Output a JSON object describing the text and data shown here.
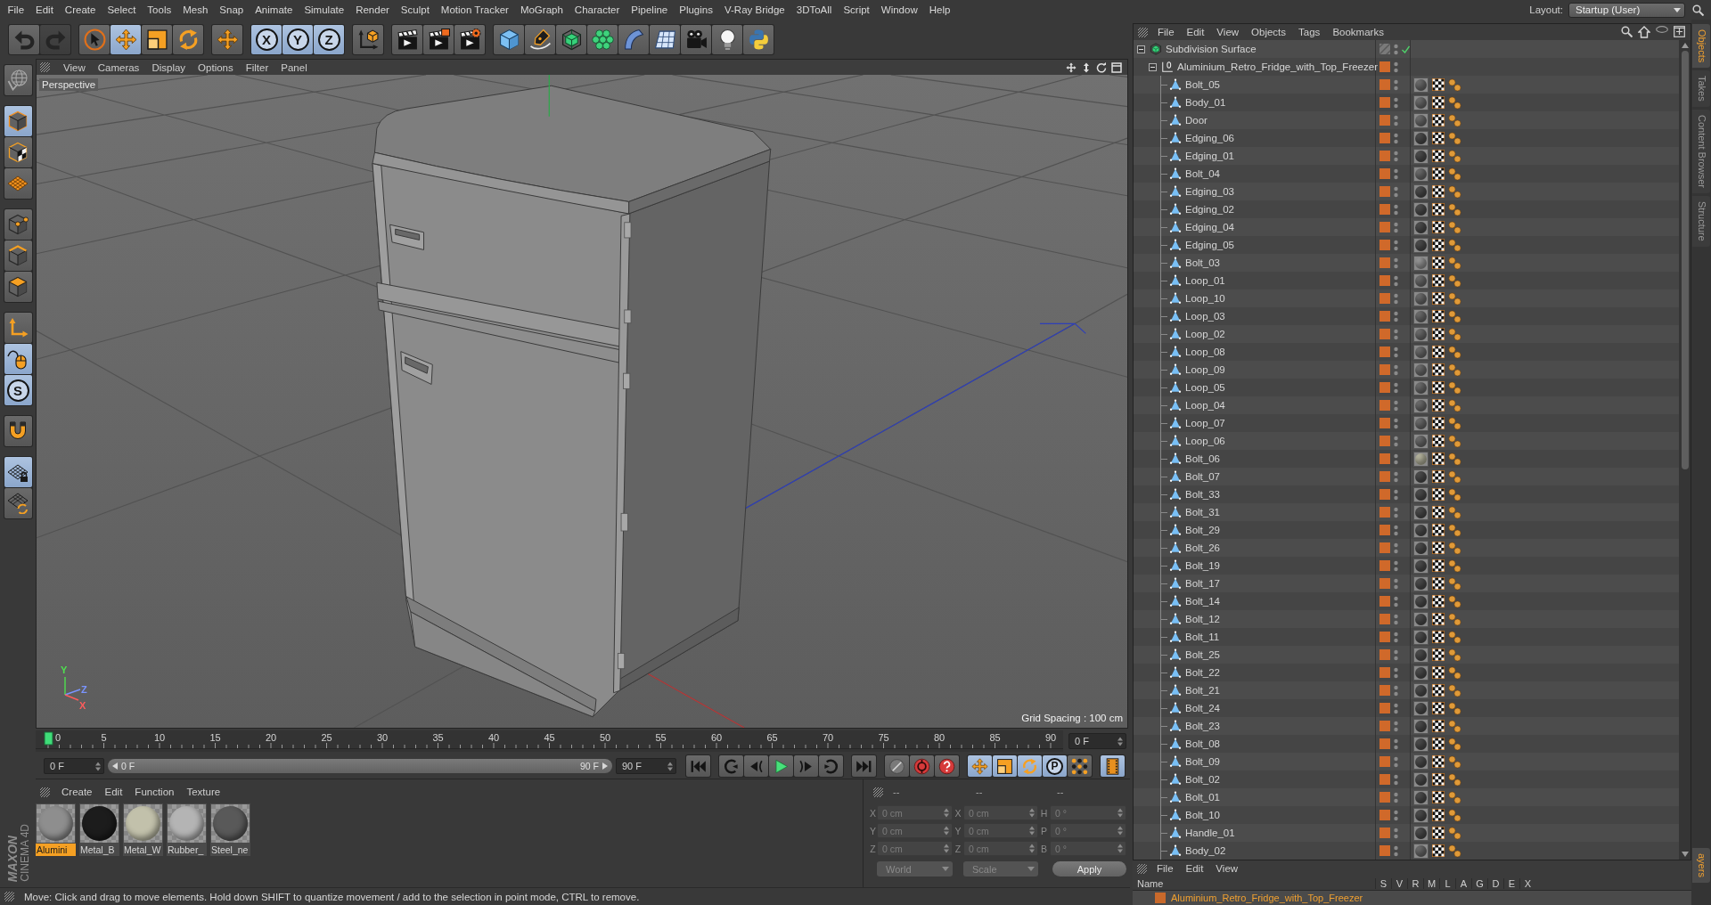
{
  "menu_bar": {
    "items": [
      "File",
      "Edit",
      "Create",
      "Select",
      "Tools",
      "Mesh",
      "Snap",
      "Animate",
      "Simulate",
      "Render",
      "Sculpt",
      "Motion Tracker",
      "MoGraph",
      "Character",
      "Pipeline",
      "Plugins",
      "V-Ray Bridge",
      "3DToAll",
      "Script",
      "Window",
      "Help"
    ],
    "layout_label": "Layout:",
    "layout_value": "Startup (User)"
  },
  "toolbar": {
    "groups": [
      [
        {
          "kind": "undo",
          "selected": false,
          "disabled": false
        },
        {
          "kind": "redo",
          "selected": false,
          "disabled": true
        }
      ],
      [
        {
          "kind": "live_selection",
          "selected": false,
          "disabled": false
        },
        {
          "kind": "move",
          "selected": true,
          "disabled": false
        },
        {
          "kind": "scale",
          "selected": false,
          "disabled": false
        },
        {
          "kind": "rotate",
          "selected": false,
          "disabled": false
        }
      ],
      [
        {
          "kind": "transform",
          "selected": false,
          "disabled": false
        }
      ],
      [
        {
          "kind": "axis_lock",
          "label": "X",
          "selected": true,
          "disabled": false
        },
        {
          "kind": "axis_lock",
          "label": "Y",
          "selected": true,
          "disabled": false
        },
        {
          "kind": "axis_lock",
          "label": "Z",
          "selected": true,
          "disabled": false
        }
      ],
      [
        {
          "kind": "coordinate_system",
          "selected": false,
          "disabled": false
        }
      ],
      [
        {
          "kind": "render_view",
          "selected": false,
          "disabled": false
        },
        {
          "kind": "render_picture",
          "selected": false,
          "disabled": false
        },
        {
          "kind": "render_settings",
          "selected": false,
          "disabled": false
        }
      ],
      [
        {
          "kind": "cube",
          "selected": false,
          "disabled": false
        },
        {
          "kind": "pen",
          "selected": false,
          "disabled": false
        },
        {
          "kind": "subdivision",
          "selected": false,
          "disabled": false
        },
        {
          "kind": "cloner",
          "selected": false,
          "disabled": false
        },
        {
          "kind": "deformer",
          "selected": false,
          "disabled": false
        },
        {
          "kind": "floor",
          "selected": false,
          "disabled": false
        },
        {
          "kind": "camera",
          "selected": false,
          "disabled": false
        },
        {
          "kind": "light",
          "selected": false,
          "disabled": false
        },
        {
          "kind": "python",
          "selected": false,
          "disabled": false
        }
      ]
    ]
  },
  "tool_strip": {
    "groups": [
      [
        {
          "kind": "globe",
          "selected": false
        }
      ],
      [
        {
          "kind": "model",
          "selected": true
        },
        {
          "kind": "texture",
          "selected": false
        },
        {
          "kind": "workplane",
          "selected": false
        }
      ],
      [
        {
          "kind": "points",
          "selected": false
        },
        {
          "kind": "edges",
          "selected": false
        },
        {
          "kind": "polygons",
          "selected": false
        }
      ],
      [
        {
          "kind": "axis",
          "selected": false
        },
        {
          "kind": "tweak",
          "selected": true
        },
        {
          "kind": "solo",
          "label": "S",
          "selected": true
        }
      ],
      [
        {
          "kind": "snap",
          "selected": false
        }
      ],
      [
        {
          "kind": "workplane_lock",
          "selected": true
        },
        {
          "kind": "grid_rotate",
          "selected": false
        }
      ]
    ]
  },
  "viewport": {
    "menu": [
      "View",
      "Cameras",
      "Display",
      "Options",
      "Filter",
      "Panel"
    ],
    "camera": "Perspective",
    "grid_spacing": "Grid Spacing : 100 cm",
    "axis_labels": [
      {
        "label": "Y",
        "color": "#4fe04f"
      },
      {
        "label": "Z",
        "color": "#7a94ff"
      },
      {
        "label": "X",
        "color": "#ff5c5c"
      }
    ]
  },
  "timeline": {
    "ticks": [
      "0",
      "5",
      "10",
      "15",
      "20",
      "25",
      "30",
      "35",
      "40",
      "45",
      "50",
      "55",
      "60",
      "65",
      "70",
      "75",
      "80",
      "85",
      "90"
    ],
    "playhead": {
      "level": 0
    },
    "current_frame": "0 F"
  },
  "transport": {
    "start_field": "0 F",
    "range_slider": {
      "start": "0 F",
      "end": "90 F",
      "level": 1
    },
    "end_field": "90 F",
    "groups": [
      [
        {
          "kind": "go_start",
          "selected": false
        }
      ],
      [
        {
          "kind": "prev_key",
          "selected": false
        },
        {
          "kind": "step_back",
          "selected": false
        },
        {
          "kind": "play",
          "selected": false
        },
        {
          "kind": "step_forward",
          "selected": false
        },
        {
          "kind": "next_key",
          "selected": false
        }
      ],
      [
        {
          "kind": "go_end",
          "selected": false
        }
      ],
      [
        {
          "kind": "keyframe",
          "selected": false
        },
        {
          "kind": "autokey",
          "selected": false
        },
        {
          "kind": "keyframe_selection",
          "selected": false
        }
      ],
      [
        {
          "kind": "filter_move",
          "selected": true
        },
        {
          "kind": "filter_scale",
          "selected": true
        },
        {
          "kind": "filter_rotate",
          "selected": true
        },
        {
          "kind": "filter_param",
          "label": "P",
          "selected": true
        },
        {
          "kind": "filter_pla",
          "selected": false
        }
      ],
      [
        {
          "kind": "timeline",
          "selected": true
        }
      ]
    ]
  },
  "materials": {
    "menu": [
      "Create",
      "Edit",
      "Function",
      "Texture"
    ],
    "items": [
      {
        "name": "Alumini",
        "color": "#8e8e8e",
        "selected": true
      },
      {
        "name": "Metal_B",
        "color": "#1c1c1c",
        "selected": false
      },
      {
        "name": "Metal_W",
        "color": "#c2c1ab",
        "selected": false
      },
      {
        "name": "Rubber_",
        "color": "#b4b4b4",
        "selected": false
      },
      {
        "name": "Steel_ne",
        "color": "#595959",
        "selected": false
      }
    ]
  },
  "coordinates": {
    "headers": [
      "--",
      "--",
      "--"
    ],
    "columns": [
      [
        {
          "axis": "X",
          "value": "0 cm"
        },
        {
          "axis": "Y",
          "value": "0 cm"
        },
        {
          "axis": "Z",
          "value": "0 cm"
        }
      ],
      [
        {
          "axis": "X",
          "value": "0 cm"
        },
        {
          "axis": "Y",
          "value": "0 cm"
        },
        {
          "axis": "Z",
          "value": "0 cm"
        }
      ],
      [
        {
          "axis": "H",
          "value": "0 °"
        },
        {
          "axis": "P",
          "value": "0 °"
        },
        {
          "axis": "B",
          "value": "0 °"
        }
      ]
    ],
    "dropdowns": [
      "World",
      "Scale"
    ],
    "apply": "Apply",
    "disabled": true
  },
  "logo": {
    "brand": "MAXON",
    "product": "CINEMA 4D"
  },
  "status_bar": "Move: Click and drag to move elements. Hold down SHIFT to quantize movement / add to the selection in point mode, CTRL to remove.",
  "object_manager": {
    "menu": [
      "File",
      "Edit",
      "View",
      "Objects",
      "Tags",
      "Bookmarks"
    ],
    "objects": [
      {
        "name": "Subdivision Surface",
        "kind": "subdivision",
        "on_layer": false,
        "enabled": true,
        "expanded": true,
        "selected": false,
        "children": [
          {
            "name": "Aluminium_Retro_Fridge_with_Top_Freezer",
            "kind": "null",
            "on_layer": true,
            "expanded": true,
            "selected": false,
            "children": [
              {
                "name": "Bolt_05",
                "kind": "polygon",
                "on_layer": true,
                "color": "#6e6e6e",
                "selected": false
              },
              {
                "name": "Body_01",
                "kind": "polygon",
                "on_layer": true,
                "color": "#6e6e6e",
                "selected": false
              },
              {
                "name": "Door",
                "kind": "polygon",
                "on_layer": true,
                "color": "#6e6e6e",
                "selected": false
              },
              {
                "name": "Edging_06",
                "kind": "polygon",
                "on_layer": true,
                "color": "#4e4e4e",
                "selected": false
              },
              {
                "name": "Edging_01",
                "kind": "polygon",
                "on_layer": true,
                "color": "#4e4e4e",
                "selected": false
              },
              {
                "name": "Bolt_04",
                "kind": "polygon",
                "on_layer": true,
                "color": "#6e6e6e",
                "selected": false
              },
              {
                "name": "Edging_03",
                "kind": "polygon",
                "on_layer": true,
                "color": "#4e4e4e",
                "selected": false
              },
              {
                "name": "Edging_02",
                "kind": "polygon",
                "on_layer": true,
                "color": "#4e4e4e",
                "selected": false
              },
              {
                "name": "Edging_04",
                "kind": "polygon",
                "on_layer": true,
                "color": "#4e4e4e",
                "selected": false
              },
              {
                "name": "Edging_05",
                "kind": "polygon",
                "on_layer": true,
                "color": "#4e4e4e",
                "selected": false
              },
              {
                "name": "Bolt_03",
                "kind": "polygon",
                "on_layer": true,
                "color": "#9a9a9a",
                "selected": false
              },
              {
                "name": "Loop_01",
                "kind": "polygon",
                "on_layer": true,
                "color": "#6e6e6e",
                "selected": false
              },
              {
                "name": "Loop_10",
                "kind": "polygon",
                "on_layer": true,
                "color": "#6e6e6e",
                "selected": false
              },
              {
                "name": "Loop_03",
                "kind": "polygon",
                "on_layer": true,
                "color": "#6e6e6e",
                "selected": false
              },
              {
                "name": "Loop_02",
                "kind": "polygon",
                "on_layer": true,
                "color": "#6e6e6e",
                "selected": false
              },
              {
                "name": "Loop_08",
                "kind": "polygon",
                "on_layer": true,
                "color": "#6e6e6e",
                "selected": false
              },
              {
                "name": "Loop_09",
                "kind": "polygon",
                "on_layer": true,
                "color": "#6e6e6e",
                "selected": false
              },
              {
                "name": "Loop_05",
                "kind": "polygon",
                "on_layer": true,
                "color": "#6e6e6e",
                "selected": false
              },
              {
                "name": "Loop_04",
                "kind": "polygon",
                "on_layer": true,
                "color": "#6e6e6e",
                "selected": false
              },
              {
                "name": "Loop_07",
                "kind": "polygon",
                "on_layer": true,
                "color": "#6e6e6e",
                "selected": false
              },
              {
                "name": "Loop_06",
                "kind": "polygon",
                "on_layer": true,
                "color": "#6e6e6e",
                "selected": false
              },
              {
                "name": "Bolt_06",
                "kind": "polygon",
                "on_layer": true,
                "color": "#bbbaa3",
                "selected": false
              },
              {
                "name": "Bolt_07",
                "kind": "polygon",
                "on_layer": true,
                "color": "#4e4e4e",
                "selected": false
              },
              {
                "name": "Bolt_33",
                "kind": "polygon",
                "on_layer": true,
                "color": "#4e4e4e",
                "selected": false
              },
              {
                "name": "Bolt_31",
                "kind": "polygon",
                "on_layer": true,
                "color": "#4e4e4e",
                "selected": false
              },
              {
                "name": "Bolt_29",
                "kind": "polygon",
                "on_layer": true,
                "color": "#4e4e4e",
                "selected": false
              },
              {
                "name": "Bolt_26",
                "kind": "polygon",
                "on_layer": true,
                "color": "#4e4e4e",
                "selected": false
              },
              {
                "name": "Bolt_19",
                "kind": "polygon",
                "on_layer": true,
                "color": "#4e4e4e",
                "selected": false
              },
              {
                "name": "Bolt_17",
                "kind": "polygon",
                "on_layer": true,
                "color": "#4e4e4e",
                "selected": false
              },
              {
                "name": "Bolt_14",
                "kind": "polygon",
                "on_layer": true,
                "color": "#4e4e4e",
                "selected": false
              },
              {
                "name": "Bolt_12",
                "kind": "polygon",
                "on_layer": true,
                "color": "#4e4e4e",
                "selected": false
              },
              {
                "name": "Bolt_11",
                "kind": "polygon",
                "on_layer": true,
                "color": "#4e4e4e",
                "selected": false
              },
              {
                "name": "Bolt_25",
                "kind": "polygon",
                "on_layer": true,
                "color": "#4e4e4e",
                "selected": false
              },
              {
                "name": "Bolt_22",
                "kind": "polygon",
                "on_layer": true,
                "color": "#4e4e4e",
                "selected": false
              },
              {
                "name": "Bolt_21",
                "kind": "polygon",
                "on_layer": true,
                "color": "#4e4e4e",
                "selected": false
              },
              {
                "name": "Bolt_24",
                "kind": "polygon",
                "on_layer": true,
                "color": "#4e4e4e",
                "selected": false
              },
              {
                "name": "Bolt_23",
                "kind": "polygon",
                "on_layer": true,
                "color": "#4e4e4e",
                "selected": false
              },
              {
                "name": "Bolt_08",
                "kind": "polygon",
                "on_layer": true,
                "color": "#4e4e4e",
                "selected": false
              },
              {
                "name": "Bolt_09",
                "kind": "polygon",
                "on_layer": true,
                "color": "#4e4e4e",
                "selected": false
              },
              {
                "name": "Bolt_02",
                "kind": "polygon",
                "on_layer": true,
                "color": "#4e4e4e",
                "selected": false
              },
              {
                "name": "Bolt_01",
                "kind": "polygon",
                "on_layer": true,
                "color": "#4e4e4e",
                "selected": false
              },
              {
                "name": "Bolt_10",
                "kind": "polygon",
                "on_layer": true,
                "color": "#4e4e4e",
                "selected": false
              },
              {
                "name": "Handle_01",
                "kind": "polygon",
                "on_layer": true,
                "color": "#4e4e4e",
                "selected": false
              },
              {
                "name": "Body_02",
                "kind": "polygon",
                "on_layer": true,
                "color": "#6e6e6e",
                "selected": false
              }
            ]
          }
        ]
      }
    ]
  },
  "layer_manager": {
    "menu": [
      "File",
      "Edit",
      "View"
    ],
    "columns": [
      "Name",
      "S",
      "V",
      "R",
      "M",
      "L",
      "A",
      "G",
      "D",
      "E",
      "X"
    ],
    "layers": [
      {
        "name": "Aluminium_Retro_Fridge_with_Top_Freezer",
        "color": "#c8692b",
        "selected": true
      }
    ]
  },
  "side_tabs": [
    {
      "label": "Objects",
      "selected": true
    },
    {
      "label": "Takes",
      "selected": false
    },
    {
      "label": "Content Browser",
      "selected": false
    },
    {
      "label": "Structure",
      "selected": false
    }
  ],
  "bottom_tabs": [
    {
      "label": "ayers",
      "selected": true
    }
  ]
}
